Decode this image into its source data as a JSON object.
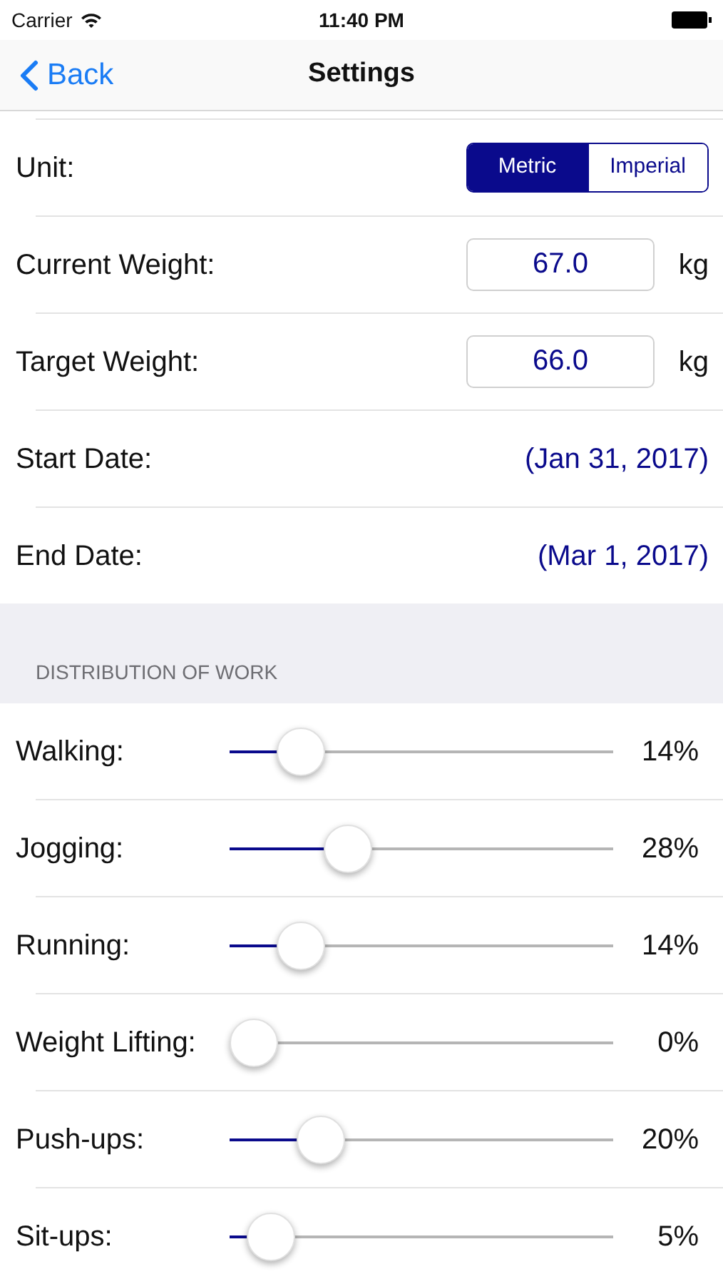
{
  "status_bar": {
    "carrier": "Carrier",
    "time": "11:40 PM"
  },
  "nav": {
    "back": "Back",
    "title": "Settings"
  },
  "settings": [
    {
      "kind": "segmented",
      "label": "Unit:",
      "options": [
        {
          "label": "Metric",
          "selected": true
        },
        {
          "label": "Imperial",
          "selected": false
        }
      ]
    },
    {
      "kind": "field",
      "label": "Current Weight:",
      "value": "67.0",
      "unit": "kg"
    },
    {
      "kind": "field",
      "label": "Target Weight:",
      "value": "66.0",
      "unit": "kg"
    },
    {
      "kind": "date",
      "label": "Start Date:",
      "value": "(Jan 31, 2017)"
    },
    {
      "kind": "date",
      "label": "End Date:",
      "value": "(Mar 1, 2017)"
    }
  ],
  "section_header": "DISTRIBUTION OF WORK",
  "sliders": [
    {
      "label": "Walking:",
      "level": 0.14,
      "reading": "14%"
    },
    {
      "label": "Jogging:",
      "level": 0.28,
      "reading": "28%"
    },
    {
      "label": "Running:",
      "level": 0.14,
      "reading": "14%"
    },
    {
      "label": "Weight Lifting:",
      "level": 0,
      "reading": "0%"
    },
    {
      "label": "Push-ups:",
      "level": 0.2,
      "reading": "20%"
    },
    {
      "label": "Sit-ups:",
      "level": 0.05,
      "reading": "5%"
    }
  ]
}
